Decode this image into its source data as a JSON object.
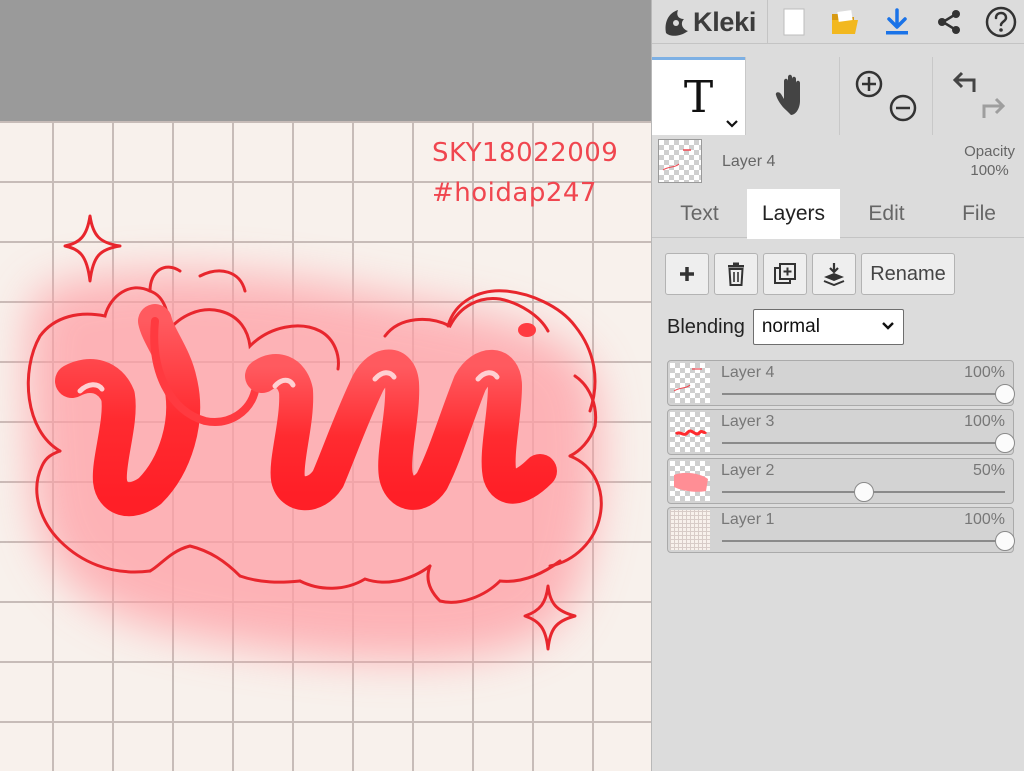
{
  "canvas": {
    "watermark_line1": "SKY18022009",
    "watermark_line2": "#hoidap247",
    "drawing_color": "#ff2a2e"
  },
  "topbar": {
    "app_name": "Kleki",
    "buttons": [
      {
        "name": "new-image",
        "icon": "page-icon"
      },
      {
        "name": "open-file",
        "icon": "folder-icon"
      },
      {
        "name": "save-download",
        "icon": "download-icon"
      },
      {
        "name": "share",
        "icon": "share-icon"
      },
      {
        "name": "help",
        "icon": "help-icon"
      }
    ]
  },
  "tools": {
    "text_tool_glyph": "T",
    "active": "text",
    "items": [
      "text",
      "hand",
      "zoom",
      "undo-redo"
    ]
  },
  "current_layer": {
    "name": "Layer 4",
    "opacity_label": "Opacity",
    "opacity_value": "100%"
  },
  "tabs": [
    {
      "label": "Text",
      "active": false
    },
    {
      "label": "Layers",
      "active": true
    },
    {
      "label": "Edit",
      "active": false
    },
    {
      "label": "File",
      "active": false
    }
  ],
  "layer_toolbar": {
    "add_icon": "plus-icon",
    "delete_icon": "trash-icon",
    "duplicate_icon": "duplicate-icon",
    "merge_icon": "merge-down-icon",
    "rename_label": "Rename"
  },
  "blending": {
    "label": "Blending",
    "value": "normal"
  },
  "layers": [
    {
      "name": "Layer 4",
      "percent": "100%",
      "opacity": 1.0,
      "selected": true
    },
    {
      "name": "Layer 3",
      "percent": "100%",
      "opacity": 1.0,
      "selected": false
    },
    {
      "name": "Layer 2",
      "percent": "50%",
      "opacity": 0.5,
      "selected": false
    },
    {
      "name": "Layer 1",
      "percent": "100%",
      "opacity": 1.0,
      "selected": false
    }
  ],
  "colors": {
    "accent_blue": "#7db0e4",
    "download_blue": "#1a73e8",
    "folder_yellow": "#f2b81f"
  }
}
